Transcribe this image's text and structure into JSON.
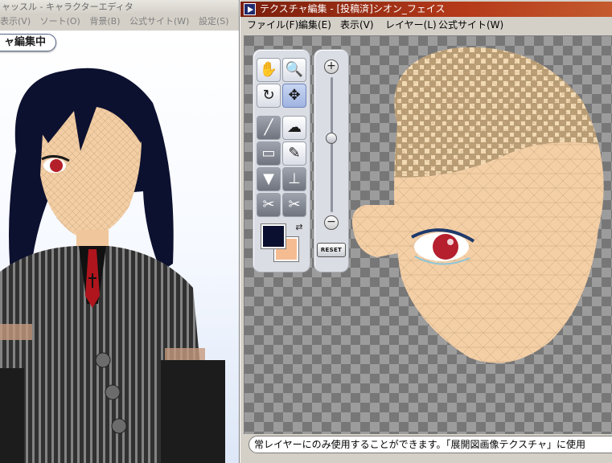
{
  "background_window": {
    "title": "ャッスル - キャラクターエディタ",
    "menu": [
      "表示(V)",
      "ソート(O)",
      "背景(B)",
      "公式サイト(W)",
      "設定(S)"
    ],
    "mode_badge": "ャ編集中"
  },
  "texture_window": {
    "title": "テクスチャ編集 - [投稿済]シオン_フェイス",
    "menu": [
      "ファイル(F)",
      "編集(E)",
      "表示(V)",
      "レイヤー(L)",
      "公式サイト(W)"
    ],
    "tools": [
      {
        "name": "hand-tool",
        "glyph": "✋"
      },
      {
        "name": "zoom-tool",
        "glyph": "🔍"
      },
      {
        "name": "rotate-tool",
        "glyph": "↻"
      },
      {
        "name": "move-tool",
        "glyph": "✥"
      },
      {
        "name": "brush-tool",
        "glyph": "╱"
      },
      {
        "name": "blur-tool",
        "glyph": "☁"
      },
      {
        "name": "eraser-tool",
        "glyph": "▭"
      },
      {
        "name": "eyedropper-tool",
        "glyph": "✎"
      },
      {
        "name": "bucket-tool",
        "glyph": "▼"
      },
      {
        "name": "stamp-tool",
        "glyph": "⊥"
      },
      {
        "name": "mirror-left-tool",
        "glyph": "✂"
      },
      {
        "name": "mirror-right-tool",
        "glyph": "✂"
      }
    ],
    "colors": {
      "foreground": "#0b1030",
      "background": "#f5bc92"
    },
    "zoom": {
      "level": 0.45,
      "plus": "+",
      "minus": "−",
      "reset_label": "RESET"
    },
    "status_text": "常レイヤーにのみ使用することができます。「展開図画像テクスチャ」に使用"
  }
}
